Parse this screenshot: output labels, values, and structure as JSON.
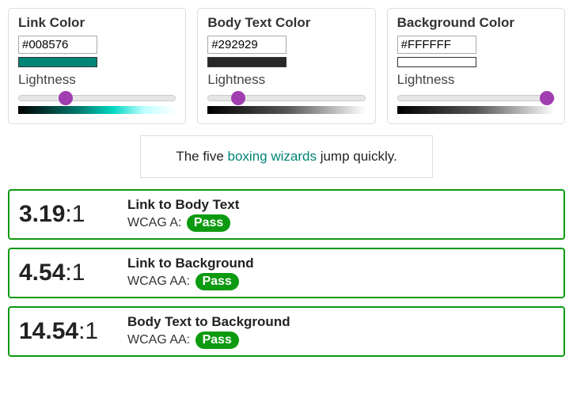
{
  "panels": {
    "link": {
      "title": "Link Color",
      "hex": "#008576",
      "lightness_label": "Lightness",
      "lightness_value": 28
    },
    "body": {
      "title": "Body Text Color",
      "hex": "#292929",
      "lightness_label": "Lightness",
      "lightness_value": 16
    },
    "bg": {
      "title": "Background Color",
      "hex": "#FFFFFF",
      "lightness_label": "Lightness",
      "lightness_value": 100
    }
  },
  "sample": {
    "pre": "The five ",
    "link": "boxing wizards",
    "post": " jump quickly."
  },
  "results": [
    {
      "ratio_bold": "3.19",
      "ratio_rest": ":1",
      "title": "Link to Body Text",
      "level_label": "WCAG A: ",
      "status": "Pass"
    },
    {
      "ratio_bold": "4.54",
      "ratio_rest": ":1",
      "title": "Link to Background",
      "level_label": "WCAG AA: ",
      "status": "Pass"
    },
    {
      "ratio_bold": "14.54",
      "ratio_rest": ":1",
      "title": "Body Text to Background",
      "level_label": "WCAG AA: ",
      "status": "Pass"
    }
  ],
  "colors": {
    "link_swatch": "#008576",
    "body_swatch": "#292929",
    "bg_swatch": "#FFFFFF"
  }
}
